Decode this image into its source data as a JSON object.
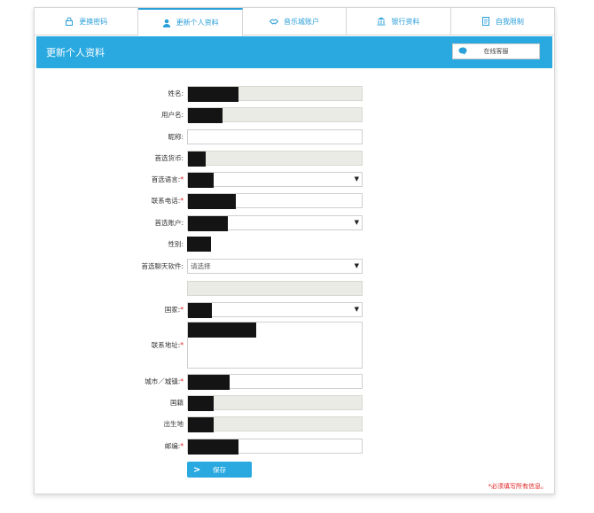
{
  "tabs": [
    {
      "label": "更换密码",
      "icon": "lock-icon"
    },
    {
      "label": "更新个人资料",
      "icon": "user-icon"
    },
    {
      "label": "音乐城账户",
      "icon": "handshake-icon"
    },
    {
      "label": "银行资料",
      "icon": "bank-icon"
    },
    {
      "label": "自我限制",
      "icon": "document-icon"
    }
  ],
  "active_tab": "更新个人资料",
  "header": {
    "title": "更新个人资料",
    "chat_button": "在线客服",
    "chat_icon": "chat-bubble-icon"
  },
  "form": {
    "name_label": "姓名:",
    "username_label": "用户名:",
    "nickname_label": "昵称:",
    "currency_label": "首选货币:",
    "language_label": "首选语言:",
    "phone_label": "联系电话:",
    "account_label": "首选账户:",
    "gender_label": "性别:",
    "chat_software_label": "首选聊天软件:",
    "chat_software_value": "请选择",
    "country_label": "国家:",
    "address_label": "联系地址:",
    "city_label": "城市／城镇:",
    "nationality_label": "国籍",
    "birthplace_label": "出生地",
    "postcode_label": "邮编:",
    "required_mark": "*"
  },
  "save_button": "保存",
  "required_note": "*必须填写所有信息。",
  "colors": {
    "accent": "#29a9e0",
    "required": "#e02020",
    "readonly_bg": "#ebebe6",
    "redaction": "#141414"
  }
}
